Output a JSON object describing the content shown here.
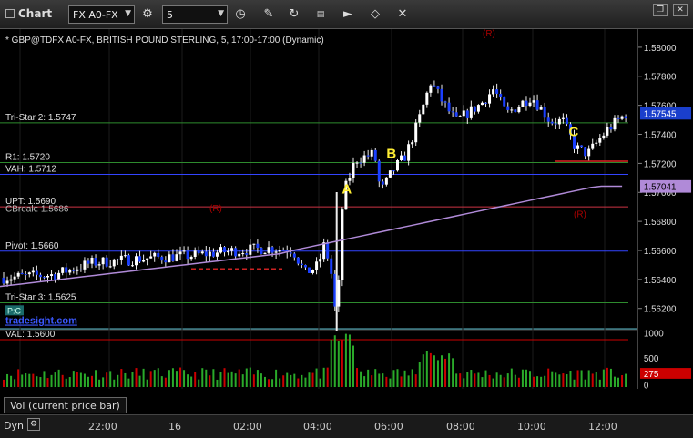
{
  "toolbar": {
    "title": "Chart",
    "symbol": "‪FX A0-FX",
    "interval": "5",
    "icons": [
      "settings-icon",
      "clock-icon",
      "pencil-icon",
      "refresh-icon",
      "calculator-icon",
      "play-icon",
      "diamond-icon",
      "close-icon"
    ]
  },
  "window": {
    "restore_icon": "restore-icon",
    "close_icon": "close-icon"
  },
  "header_text": "* GBP@TDFX A0-FX, BRITISH POUND STERLING, 5, 17:00-17:00 (Dynamic)",
  "top_marker": "(R)",
  "levels": [
    {
      "label": "Tri-Star 2: 1.5747",
      "price": 1.5747,
      "color": "#2e8b2e"
    },
    {
      "label": "R1: 1.5720",
      "price": 1.572,
      "color": "#2e8b2e"
    },
    {
      "label": "VAH: 1.5712",
      "price": 1.5712,
      "color": "#3344ff"
    },
    {
      "label": "UPT: 1.5690",
      "price": 1.569,
      "color": "#cc3344"
    },
    {
      "label": "Pivot: 1.5660",
      "price": 1.566,
      "color": "#3344ff"
    },
    {
      "label": "Tri-Star 3: 1.5625",
      "price": 1.5625,
      "color": "#2e8b2e"
    },
    {
      "label": "VAL: 1.5600",
      "price": 1.56,
      "color": "#cc0000"
    }
  ],
  "overlap_text": "CBreak: 1.5686",
  "watermark": "tradesight.com",
  "pc_tag": "P:C",
  "letters": [
    {
      "text": "A",
      "t": 54.4,
      "price": 1.5699
    },
    {
      "text": "B",
      "t": 61.5,
      "price": 1.5723
    },
    {
      "text": "C",
      "t": 90.5,
      "price": 1.5738
    }
  ],
  "price_axis": {
    "ticks": [
      "1.58000",
      "1.57800",
      "1.57600",
      "1.57400",
      "1.57200",
      "1.57000",
      "1.56800",
      "1.56600",
      "1.56400",
      "1.56200"
    ],
    "last_price": "1.57545",
    "last_price_color": "#1a3fcc",
    "ma_price": "1.57041",
    "ma_color": "#b08ad8",
    "min": 1.5608,
    "max": 1.5808
  },
  "volume_axis": {
    "ticks": [
      "1000",
      "500",
      "0"
    ],
    "last": "275",
    "last_color": "#cc0000"
  },
  "volume_tab": "Vol (current price bar)",
  "bottom": {
    "dyn_label": "Dyn",
    "dyn_icon": "settings-icon",
    "time_labels": [
      "22:00",
      "16",
      "02:00",
      "04:00",
      "06:00",
      "08:00",
      "10:00",
      "12:00"
    ]
  }
}
